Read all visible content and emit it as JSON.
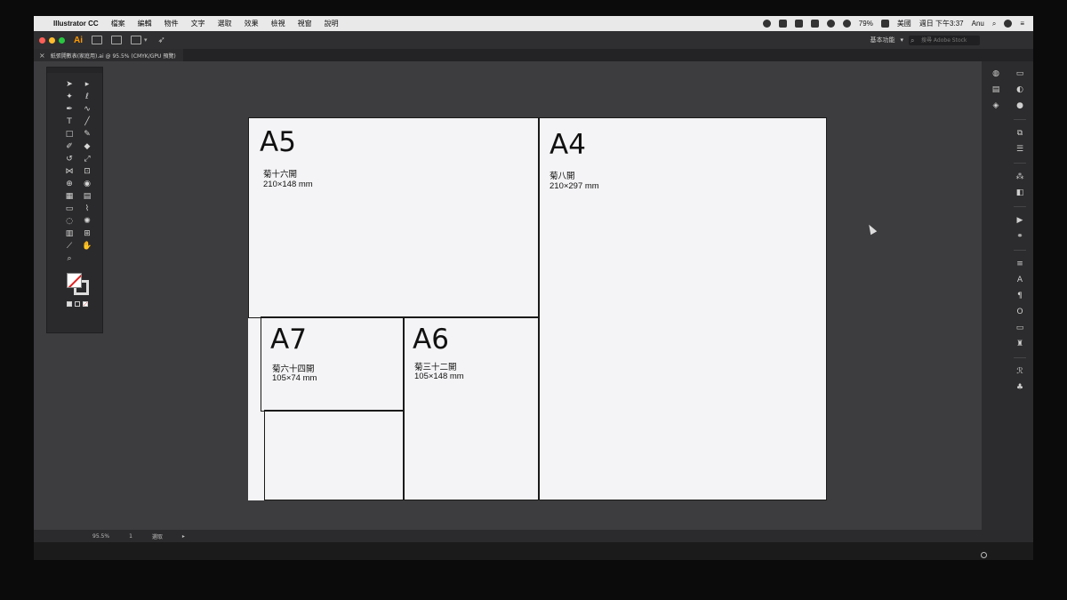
{
  "menubar": {
    "app_name": "Illustrator CC",
    "items": [
      "檔案",
      "編輯",
      "物件",
      "文字",
      "選取",
      "效果",
      "檢視",
      "視窗",
      "說明"
    ],
    "battery": "79%",
    "input_source": "美國",
    "clock": "週日 下午3:37",
    "user": "Anu"
  },
  "appbar": {
    "logo": "Ai",
    "workspace": "基本功能",
    "search_placeholder": "搜尋 Adobe Stock"
  },
  "document": {
    "tab_title": "紙張開數表(家庭用).ai @ 95.5% (CMYK/GPU 預覽)"
  },
  "artboard": {
    "a5": {
      "title": "A5",
      "name": "菊十六開",
      "size": "210×148 mm"
    },
    "a4": {
      "title": "A4",
      "name": "菊八開",
      "size": "210×297 mm"
    },
    "a7": {
      "title": "A7",
      "name": "菊六十四開",
      "size": "105×74 mm"
    },
    "a6": {
      "title": "A6",
      "name": "菊三十二開",
      "size": "105×148 mm"
    }
  },
  "statusbar": {
    "zoom": "95.5%",
    "artboard_number": "1",
    "tool_name": "選取"
  },
  "colors": {
    "menubar_bg": "#e9e9ea",
    "app_bg": "#2f2f31",
    "pasteboard": "#3d3d40",
    "artboard": "#f4f4f6",
    "ai_orange": "#ff9a00"
  },
  "icons": {
    "traffic_lights": [
      "#ff5f57",
      "#febc2e",
      "#28c840"
    ]
  }
}
